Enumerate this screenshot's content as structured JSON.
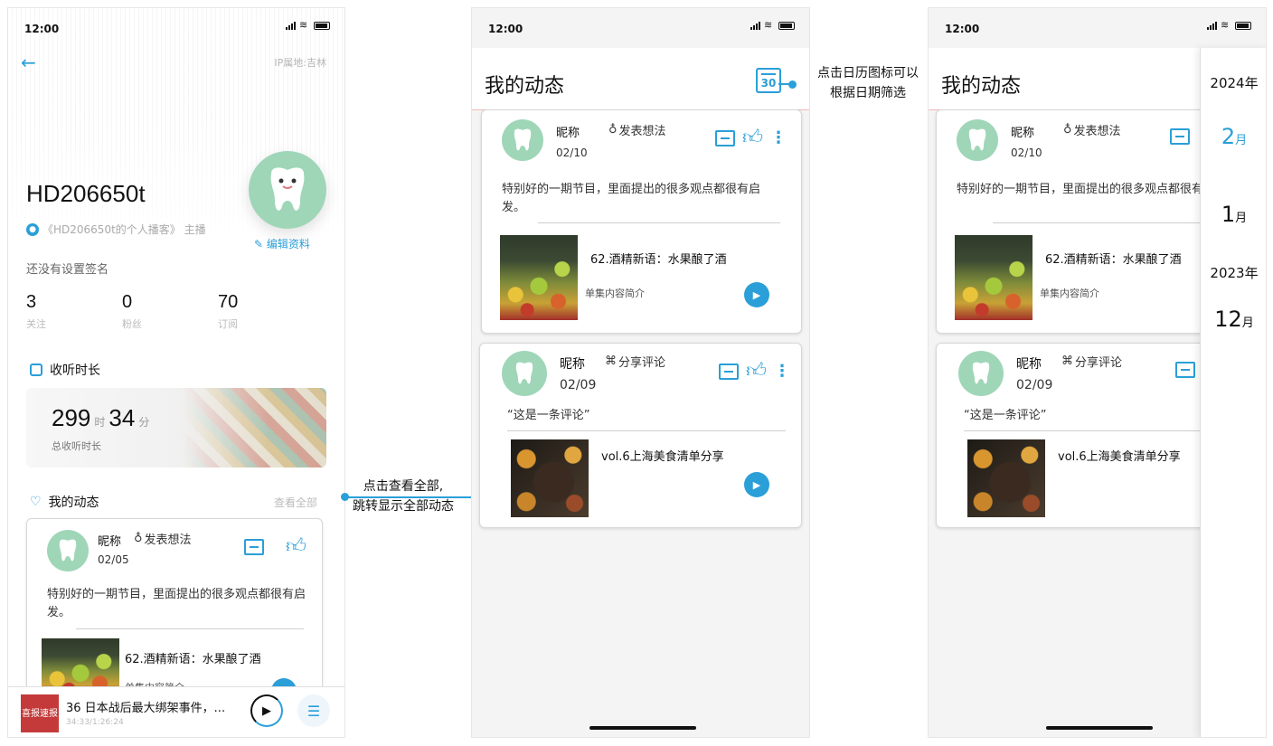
{
  "status": {
    "time": "12:00"
  },
  "profile": {
    "ip": "IP属地:吉林",
    "username": "HD206650t",
    "podcast": "《HD206650t的个人播客》 主播",
    "edit_label": "编辑资料",
    "signature": "还没有设置签名",
    "stats": [
      {
        "value": "3",
        "label": "关注"
      },
      {
        "value": "0",
        "label": "粉丝"
      },
      {
        "value": "70",
        "label": "订阅"
      }
    ],
    "listen_section": "收听时长",
    "listen_hours": "299",
    "hour_unit": "时",
    "listen_minutes": "34",
    "minute_unit": "分",
    "listen_caption": "总收听时长",
    "moments_section": "我的动态",
    "view_all": "查看全部",
    "post": {
      "nick": "昵称",
      "tag": "发表想法",
      "date": "02/05",
      "text": "特别好的一期节目，里面提出的很多观点都很有启发。",
      "episode": "62.酒精新语：水果酿了酒",
      "intro": "单集内容简介"
    },
    "player": {
      "cover_text": "喜报速报",
      "title": "36 日本战后最大绑架事件，...",
      "time": "34:33/1:26:24"
    }
  },
  "moments": {
    "title": "我的动态",
    "calendar_icon_text": "30",
    "posts": [
      {
        "nick": "昵称",
        "tag": "发表想法",
        "date": "02/10",
        "text": "特别好的一期节目，里面提出的很多观点都很有启发。",
        "episode": "62.酒精新语：水果酿了酒",
        "intro": "单集内容简介"
      },
      {
        "nick": "昵称",
        "tag": "分享评论",
        "date": "02/09",
        "text": "“这是一条评论”",
        "episode": "vol.6上海美食清单分享"
      }
    ]
  },
  "filter": {
    "year1": "2024年",
    "m1_num": "2",
    "m1_unit": "月",
    "m2_num": "1",
    "m2_unit": "月",
    "year2": "2023年",
    "m3_num": "12",
    "m3_unit": "月"
  },
  "annotations": {
    "view_all_line1": "点击查看全部,",
    "view_all_line2": "跳转显示全部动态",
    "calendar_line1": "点击日历图标可以",
    "calendar_line2": "根据日期筛选"
  },
  "colors": {
    "accent": "#2a9fd8",
    "avatar_bg": "#9fd6b8"
  }
}
